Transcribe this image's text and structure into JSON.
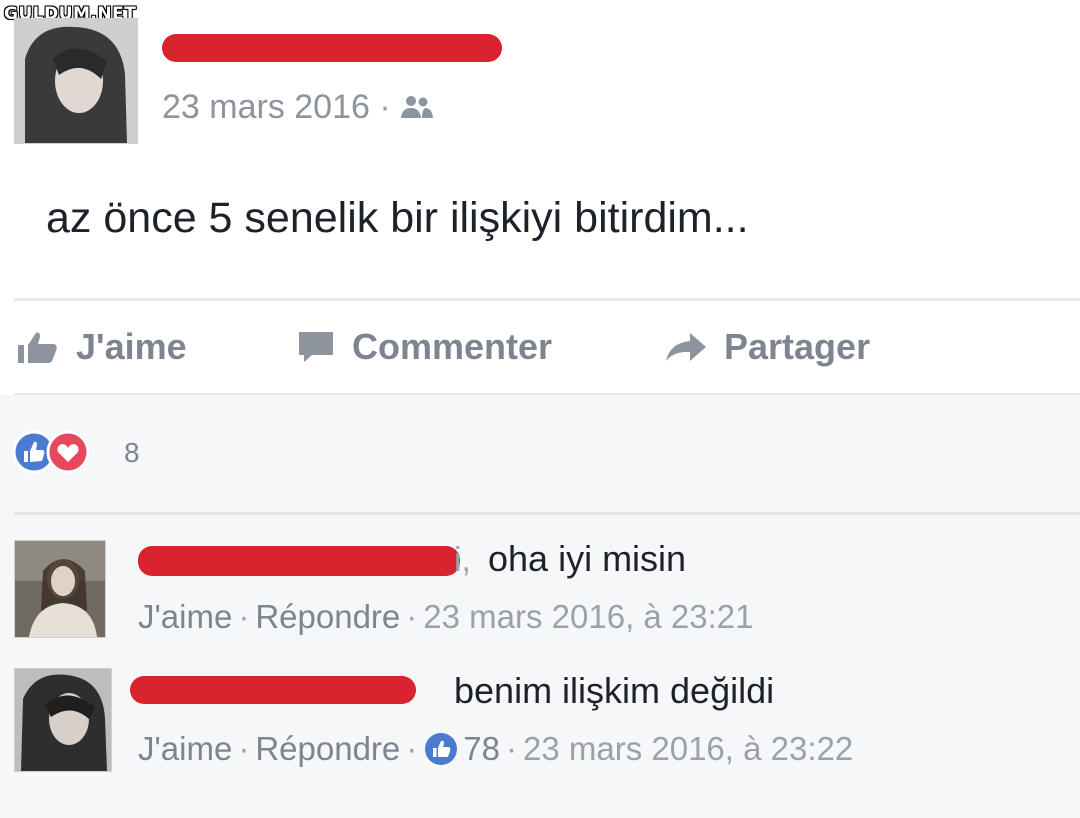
{
  "watermark": "GULDUM.NET",
  "post": {
    "date": "23 mars 2016",
    "audience_icon": "friends-icon",
    "text": "az önce 5 senelik bir ilişkiyi bitirdim..."
  },
  "actions": {
    "like": "J'aime",
    "comment": "Commenter",
    "share": "Partager"
  },
  "reactions": {
    "icons": [
      "like-icon",
      "love-icon"
    ],
    "count": "8"
  },
  "comments": [
    {
      "name_fragment": "i,",
      "text": "oha iyi misin",
      "like": "J'aime",
      "reply": "Répondre",
      "date": "23 mars 2016, à 23:21"
    },
    {
      "text": "benim ilişkim değildi",
      "like": "J'aime",
      "reply": "Répondre",
      "likes": "78",
      "date": "23 mars 2016, à 23:22"
    }
  ],
  "colors": {
    "redaction": "#d9232f",
    "like_blue": "#4a7bd0",
    "love_red": "#e8485e",
    "grey_text": "#8d949e"
  }
}
